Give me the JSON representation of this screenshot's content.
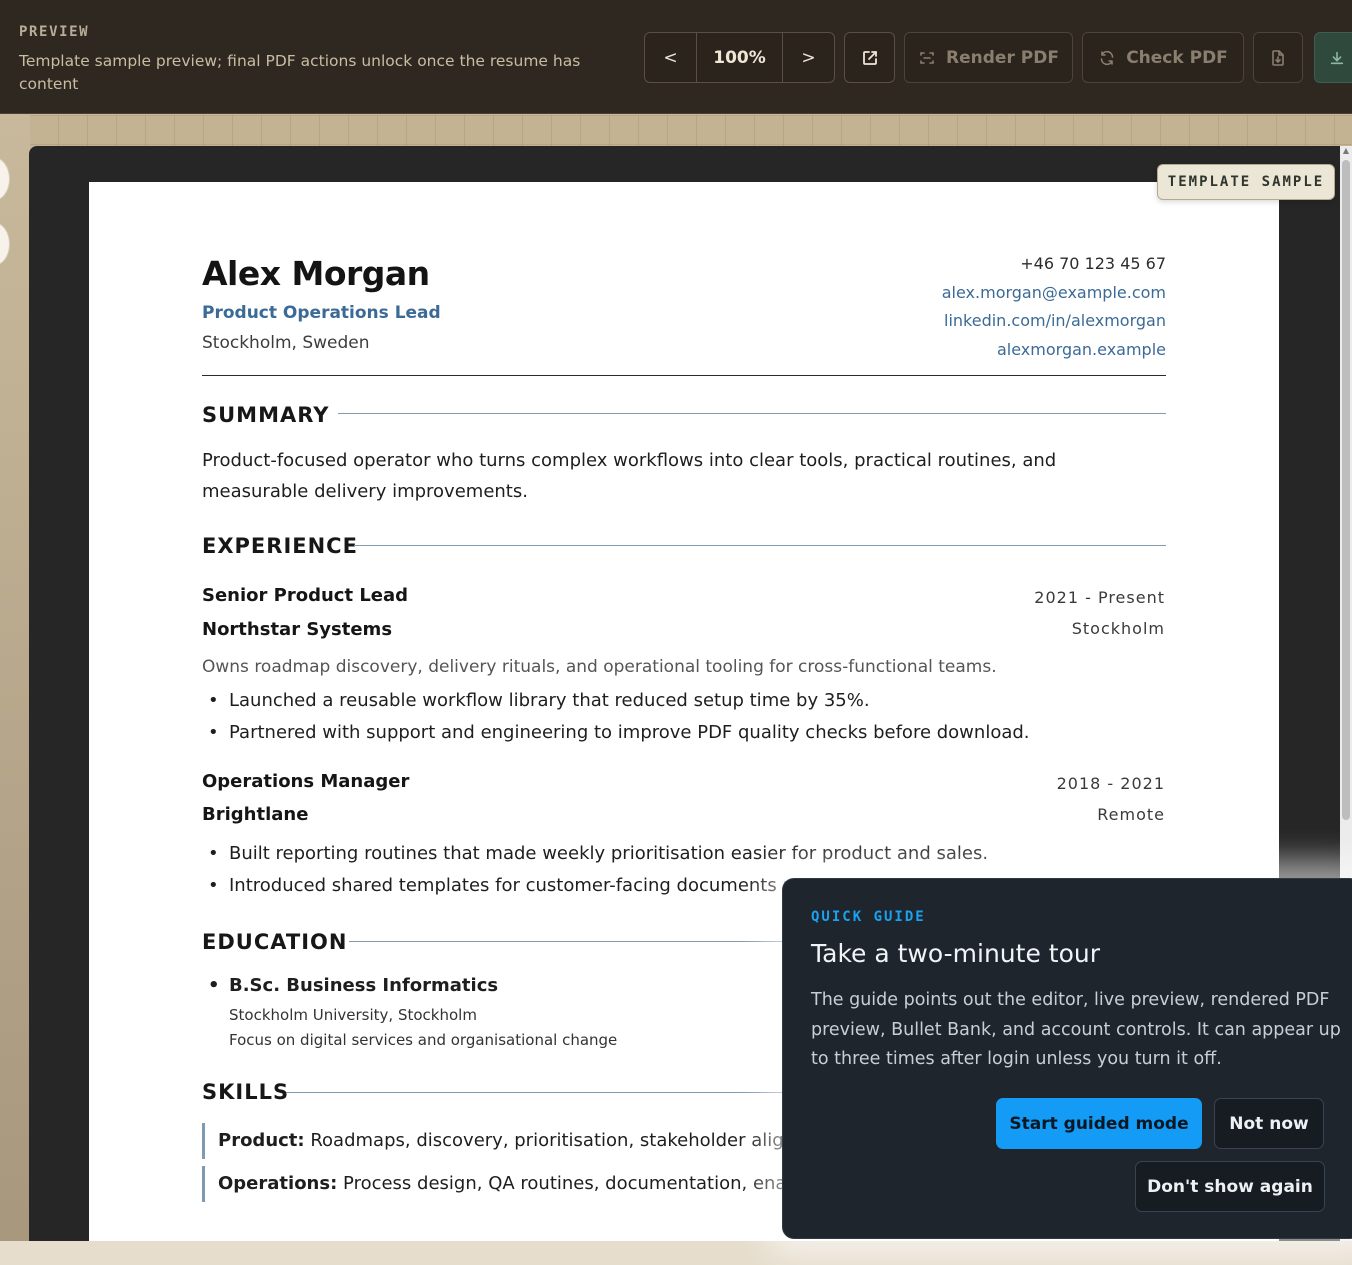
{
  "toolbar": {
    "label": "PREVIEW",
    "description": "Template sample preview; final PDF actions unlock once the resume has content",
    "zoom_prev": "<",
    "zoom_value": "100%",
    "zoom_next": ">",
    "render_pdf": "Render PDF",
    "check_pdf": "Check PDF"
  },
  "badge": "TEMPLATE SAMPLE",
  "resume": {
    "name": "Alex Morgan",
    "role": "Product Operations Lead",
    "location": "Stockholm, Sweden",
    "contact": {
      "phone": "+46 70 123 45 67",
      "email": "alex.morgan@example.com",
      "linkedin": "linkedin.com/in/alexmorgan",
      "website": "alexmorgan.example"
    },
    "summary_title": "SUMMARY",
    "summary_text": "Product-focused operator who turns complex workflows into clear tools, practical routines, and measurable delivery improvements.",
    "experience_title": "EXPERIENCE",
    "jobs": [
      {
        "title": "Senior Product Lead",
        "company": "Northstar Systems",
        "dates": "2021 - Present",
        "place": "Stockholm",
        "description": "Owns roadmap discovery, delivery rituals, and operational tooling for cross-functional teams.",
        "bullets": [
          "Launched a reusable workflow library that reduced setup time by 35%.",
          "Partnered with support and engineering to improve PDF quality checks before download."
        ]
      },
      {
        "title": "Operations Manager",
        "company": "Brightlane",
        "dates": "2018 - 2021",
        "place": "Remote",
        "bullets": [
          "Built reporting routines that made weekly prioritisation easier for product and sales.",
          "Introduced shared templates for customer-facing documents a"
        ]
      }
    ],
    "education_title": "EDUCATION",
    "education": {
      "degree": "B.Sc. Business Informatics",
      "school": "Stockholm University, Stockholm",
      "focus": "Focus on digital services and organisational change"
    },
    "skills_title": "SKILLS",
    "skills": [
      {
        "label": "Product:",
        "value": "Roadmaps, discovery, prioritisation, stakeholder alignm"
      },
      {
        "label": "Operations:",
        "value": "Process design, QA routines, documentation, enab"
      }
    ]
  },
  "guide": {
    "kicker": "QUICK GUIDE",
    "title": "Take a two-minute tour",
    "body": "The guide points out the editor, live preview, rendered PDF preview, Bullet Bank, and account controls. It can appear up to three times after login unless you turn it off.",
    "start": "Start guided mode",
    "not_now": "Not now",
    "dont_show": "Don't show again"
  },
  "colors": {
    "toolbar_bg": "#2e2820",
    "accent_blue": "#3b6a96",
    "guide_bg": "#1f252c",
    "guide_primary": "#139bf5",
    "download_green": "#2f4a3d"
  },
  "icons": {
    "open_external": "external-link-icon",
    "render": "scan-icon",
    "check": "refresh-icon",
    "file": "file-download-icon",
    "download": "download-icon"
  }
}
